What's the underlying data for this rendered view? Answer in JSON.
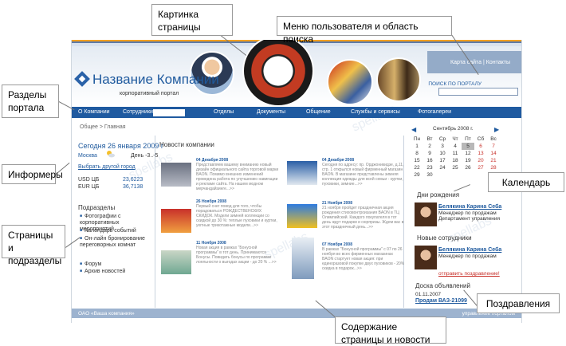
{
  "callouts": {
    "sections": "Разделы портала",
    "informers": "Информеры",
    "pages": "Страницы и подразделы",
    "picture": "Картинка страницы",
    "menu": "Меню пользователя и область поиска",
    "calendar": "Календарь",
    "congrats": "Поздравления",
    "content": "Содержание страницы и новости"
  },
  "header": {
    "company_name": "Название Компании",
    "tagline": "корпоративный портал",
    "top_links": "Карта сайта | Контакты",
    "search_label": "ПОИСК ПО ПОРТАЛУ"
  },
  "nav": [
    "О Компании",
    "Сотрудники",
    "Отделы",
    "Документы",
    "Общение",
    "Службы и сервисы",
    "Фотогалереи"
  ],
  "breadcrumb": "Общее > Главная",
  "informer": {
    "date": "Сегодня 26 января 2009 г",
    "city": "Москва",
    "temp": "День -3..-5",
    "choose_city": "Выбрать другой город",
    "currencies": [
      {
        "code": "USD ЦБ",
        "value": "23,6223"
      },
      {
        "code": "EUR ЦБ",
        "value": "36,7138"
      }
    ]
  },
  "subsections": {
    "title": "Подразделы",
    "items": [
      "Фотографии с корпоративных мероприятий",
      "Календарь событий",
      "Он-лайн бронирование переговорных комнат",
      "Форум",
      "Архив новостей"
    ]
  },
  "news": {
    "title": "Новости компании",
    "items": [
      {
        "date": "04 Декабря 2008",
        "text": "Представляем вашему вниманию новый дизайн официального сайта торговой марки BAON. Помимо внешних изменений проведена работа по улучшению навигации и рекламе сайта. На нашем модном мерчандайзинге...>>"
      },
      {
        "date": "04 Декабря 2008",
        "text": "Сегодня по адресу: пр. Орджоникидзе, д.11, стр. 1 открылся новый фирменный магазин BAON. В магазине представлены зимняя коллекция одежды для всей семьи - куртки, пуховики, зимние...>>"
      },
      {
        "date": "26 Ноября 2008",
        "text": "Первый снег повод для того, чтобы порадоваться РОЖДЕСТВЕНСКИХ СКИДОК. Модели зимней коллекции со скидкой до 30 %: теплые пуховики и куртки, уютные трикотажные модели...>>"
      },
      {
        "date": "21 Ноября 2008",
        "text": "21 ноября пройдет праздничная акция рождения стиховонтроизания BAON в ТЦ Олимпийский. Каждого покупателя в тот день ждут подарки и сюрпризы. Ждем вас в этот праздничный день...>>"
      },
      {
        "date": "11 Ноября 2008",
        "text": "Новая акция в рамках \"Бонусной программы\" в тот день. Принимаются Бонусы. Повидать бонусы по программе лояльности о выгодах акции - до 20 % ...>>"
      },
      {
        "date": "07 Ноября 2008",
        "text": "В рамках \"Бонусной программы\" с 07 по 26 ноября во всех фирменных магазинах BAON стартует новая акция: при единоразовой покупке двух пуховиков - 20% скидка в подарок...>>"
      }
    ]
  },
  "calendar": {
    "title": "Сентябрь 2008 г.",
    "weekdays": [
      "Пн",
      "Вт",
      "Ср",
      "Чт",
      "Пт",
      "Сб",
      "Вс"
    ],
    "weeks": [
      [
        "1",
        "2",
        "3",
        "4",
        "5",
        "6",
        "7"
      ],
      [
        "8",
        "9",
        "10",
        "11",
        "12",
        "13",
        "14"
      ],
      [
        "15",
        "16",
        "17",
        "18",
        "19",
        "20",
        "21"
      ],
      [
        "22",
        "23",
        "24",
        "25",
        "26",
        "27",
        "28"
      ],
      [
        "29",
        "30",
        "",
        "",
        "",
        "",
        ""
      ]
    ],
    "today": "5"
  },
  "birthdays": {
    "title": "Дни рождения",
    "name": "Белякина Карина Себа",
    "role": "Менеджер по продажам Департамент управления"
  },
  "new_staff": {
    "title": "Новые сотрудники",
    "name": "Белякина Карина Себа",
    "role": "Менеджер по продажам"
  },
  "congrats_link": "отправить поздравление!",
  "board": {
    "title": "Доска объявлений",
    "date": "01.11.2007",
    "item": "Продам ВАЗ-21099"
  },
  "footer": {
    "left": "ОАО «Ваша компания»",
    "right": "управление порталом"
  },
  "watermark": "spellabs"
}
